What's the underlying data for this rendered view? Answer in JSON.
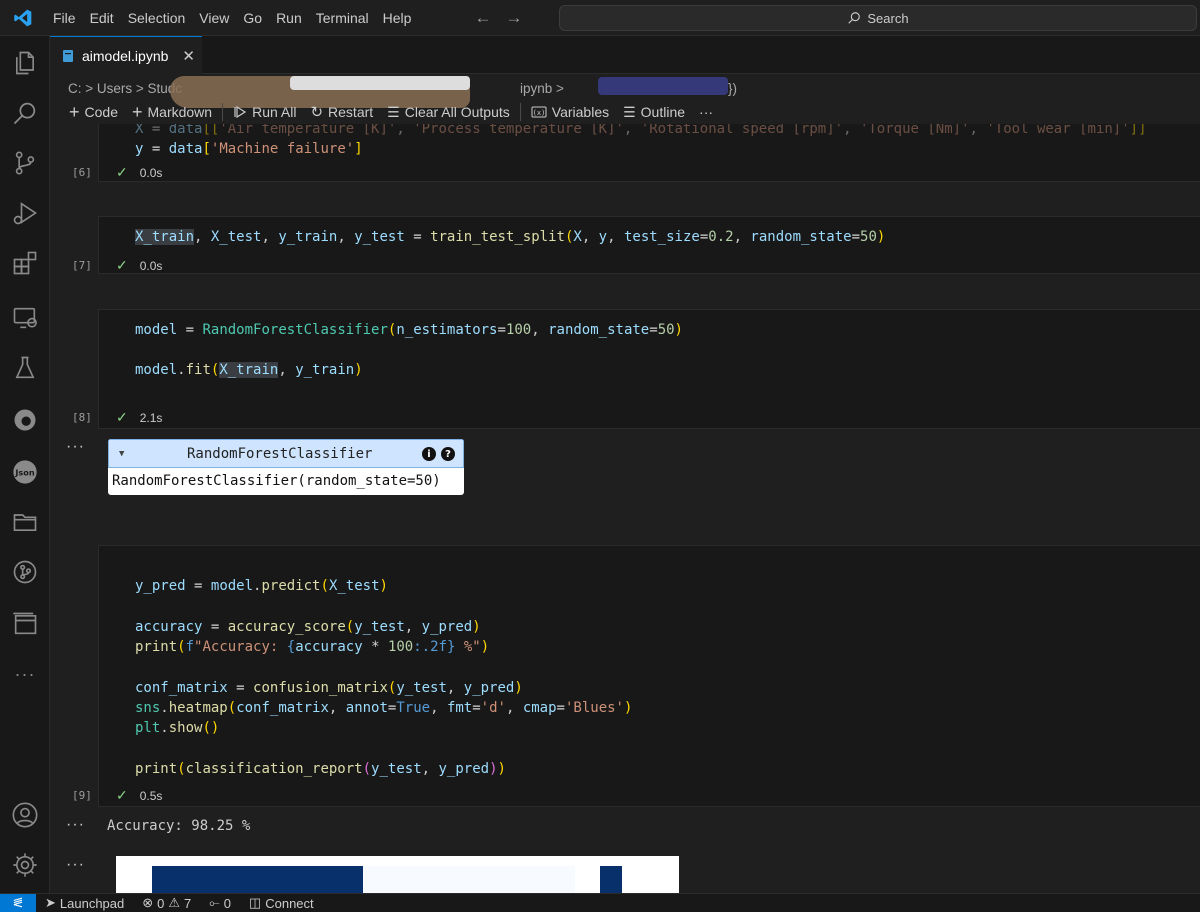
{
  "menu": [
    "File",
    "Edit",
    "Selection",
    "View",
    "Go",
    "Run",
    "Terminal",
    "Help"
  ],
  "search": {
    "label": "Search"
  },
  "tab": {
    "title": "aimodel.ipynb"
  },
  "breadcrumb": {
    "path": "C: > Users > Studc",
    "tail": "ipynb >",
    "end": "})"
  },
  "toolbar": {
    "code": "Code",
    "markdown": "Markdown",
    "run_all": "Run All",
    "restart": "Restart",
    "clear_all": "Clear All Outputs",
    "variables": "Variables",
    "outline": "Outline",
    "more": "···"
  },
  "cells": [
    {
      "count": "[6]",
      "time": "0.0s"
    },
    {
      "count": "[7]",
      "time": "0.0s"
    },
    {
      "count": "[8]",
      "time": "2.1s"
    },
    {
      "count": "[9]",
      "time": "0.5s"
    }
  ],
  "output": {
    "rf_title": "RandomForestClassifier",
    "rf_repr": "RandomForestClassifier(random_state=50)",
    "accuracy": "Accuracy: 98.25 %",
    "ellipsis": "···"
  },
  "statusbar": {
    "launchpad": "Launchpad",
    "errors": "0",
    "warnings": "7",
    "ports": "0",
    "connect": "Connect"
  },
  "colors": {
    "accent": "#0078d4",
    "success": "#89d185"
  }
}
